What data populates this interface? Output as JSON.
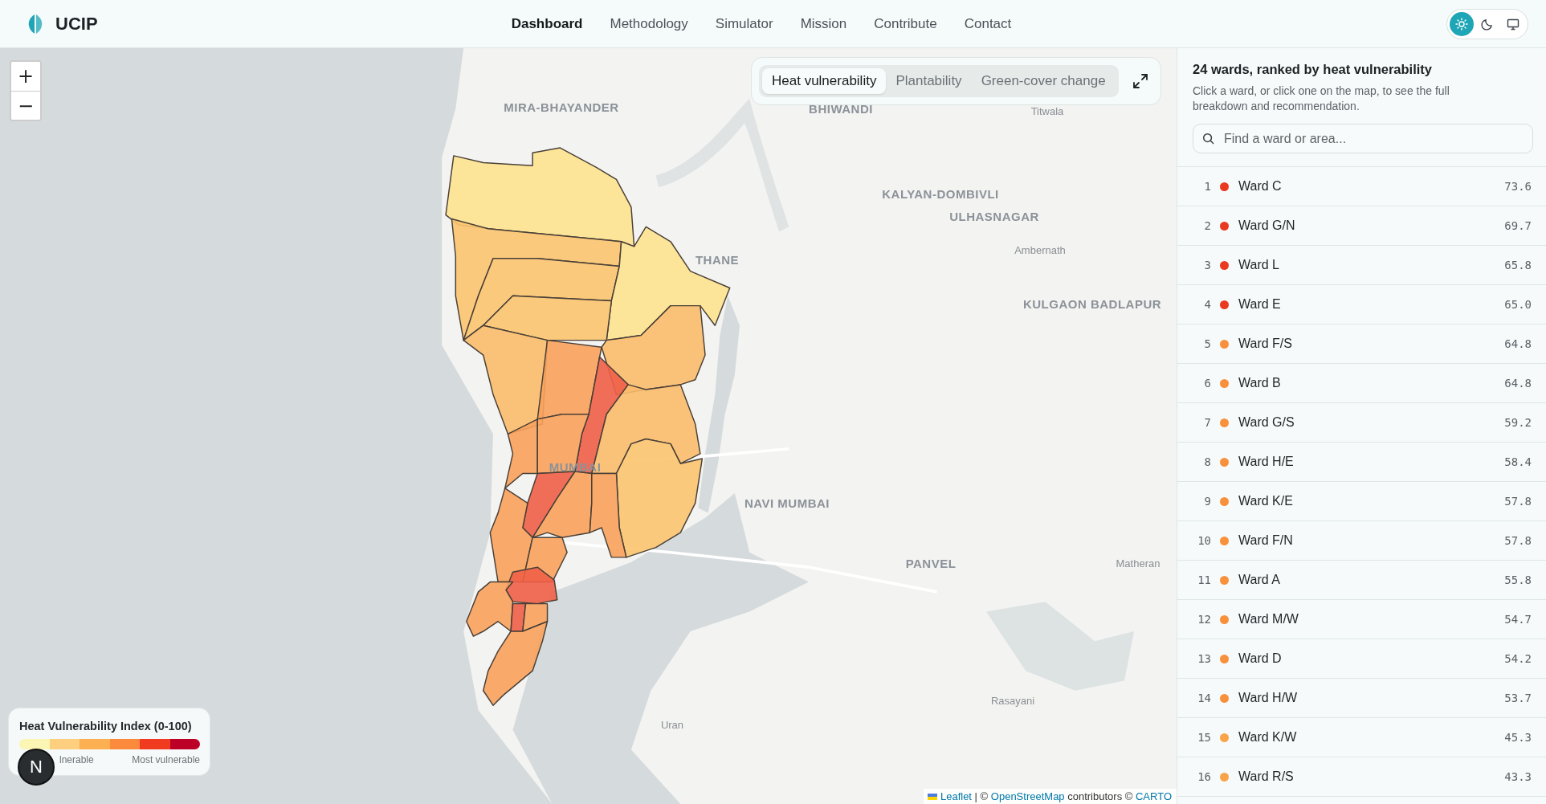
{
  "header": {
    "brand": "UCIP",
    "nav": [
      {
        "label": "Dashboard",
        "selected": true
      },
      {
        "label": "Methodology",
        "selected": false
      },
      {
        "label": "Simulator",
        "selected": false
      },
      {
        "label": "Mission",
        "selected": false
      },
      {
        "label": "Contribute",
        "selected": false
      },
      {
        "label": "Contact",
        "selected": false
      }
    ],
    "theme_modes": [
      {
        "kind": "light",
        "selected": true
      },
      {
        "kind": "dark",
        "selected": false
      },
      {
        "kind": "system",
        "selected": false
      }
    ]
  },
  "map": {
    "zoom_controls": [
      "+",
      "−"
    ],
    "layers": [
      {
        "label": "Heat vulnerability",
        "selected": true
      },
      {
        "label": "Plantability",
        "selected": false
      },
      {
        "label": "Green-cover change",
        "selected": false
      }
    ],
    "place_labels": [
      {
        "text": "MIRA-BHAYANDER",
        "kind": "city"
      },
      {
        "text": "BHIWANDI",
        "kind": "city"
      },
      {
        "text": "Titwala",
        "kind": "town"
      },
      {
        "text": "KALYAN-DOMBIVLI",
        "kind": "city"
      },
      {
        "text": "ULHASNAGAR",
        "kind": "city"
      },
      {
        "text": "THANE",
        "kind": "city"
      },
      {
        "text": "Ambernath",
        "kind": "town"
      },
      {
        "text": "KULGAON BADLAPUR",
        "kind": "city"
      },
      {
        "text": "MUMBAI",
        "kind": "city"
      },
      {
        "text": "NAVI MUMBAI",
        "kind": "city"
      },
      {
        "text": "PANVEL",
        "kind": "city"
      },
      {
        "text": "Matheran",
        "kind": "town"
      },
      {
        "text": "Rasayani",
        "kind": "town"
      },
      {
        "text": "Uran",
        "kind": "town"
      }
    ],
    "legend": {
      "title": "Heat Vulnerability Index (0-100)",
      "swatches": [
        {
          "color": "#fbf6b4"
        },
        {
          "color": "#fdcf7e"
        },
        {
          "color": "#fdb052"
        },
        {
          "color": "#fb8a3c"
        },
        {
          "color": "#f03b20"
        },
        {
          "color": "#bd0026"
        }
      ],
      "min_label": "lnerable",
      "max_label": "Most vulnerable"
    },
    "dev_badge": "N",
    "attribution": [
      {
        "kind": "link",
        "text": "Leaflet"
      },
      {
        "kind": "text",
        "text": "| ©"
      },
      {
        "kind": "link",
        "text": "OpenStreetMap"
      },
      {
        "kind": "text",
        "text": "contributors ©"
      },
      {
        "kind": "link",
        "text": "CARTO"
      }
    ]
  },
  "panel": {
    "title": "24 wards, ranked by heat vulnerability",
    "description": "Click a ward, or click one on the map, to see the full breakdown and recommendation.",
    "search": {
      "placeholder": "Find a ward or area..."
    },
    "wards": [
      {
        "rank": "1",
        "name": "Ward C",
        "score": "73.6",
        "color": "#e9391f"
      },
      {
        "rank": "2",
        "name": "Ward G/N",
        "score": "69.7",
        "color": "#e9391f"
      },
      {
        "rank": "3",
        "name": "Ward L",
        "score": "65.8",
        "color": "#e9391f"
      },
      {
        "rank": "4",
        "name": "Ward E",
        "score": "65.0",
        "color": "#e9391f"
      },
      {
        "rank": "5",
        "name": "Ward F/S",
        "score": "64.8",
        "color": "#f8903c"
      },
      {
        "rank": "6",
        "name": "Ward B",
        "score": "64.8",
        "color": "#f8903c"
      },
      {
        "rank": "7",
        "name": "Ward G/S",
        "score": "59.2",
        "color": "#f8903c"
      },
      {
        "rank": "8",
        "name": "Ward H/E",
        "score": "58.4",
        "color": "#f8903c"
      },
      {
        "rank": "9",
        "name": "Ward K/E",
        "score": "57.8",
        "color": "#f8903c"
      },
      {
        "rank": "10",
        "name": "Ward F/N",
        "score": "57.8",
        "color": "#f8903c"
      },
      {
        "rank": "11",
        "name": "Ward A",
        "score": "55.8",
        "color": "#f8903c"
      },
      {
        "rank": "12",
        "name": "Ward M/W",
        "score": "54.7",
        "color": "#f8903c"
      },
      {
        "rank": "13",
        "name": "Ward D",
        "score": "54.2",
        "color": "#f8903c"
      },
      {
        "rank": "14",
        "name": "Ward H/W",
        "score": "53.7",
        "color": "#f8903c"
      },
      {
        "rank": "15",
        "name": "Ward K/W",
        "score": "45.3",
        "color": "#f9a449"
      },
      {
        "rank": "16",
        "name": "Ward R/S",
        "score": "43.3",
        "color": "#f9a449"
      }
    ]
  }
}
